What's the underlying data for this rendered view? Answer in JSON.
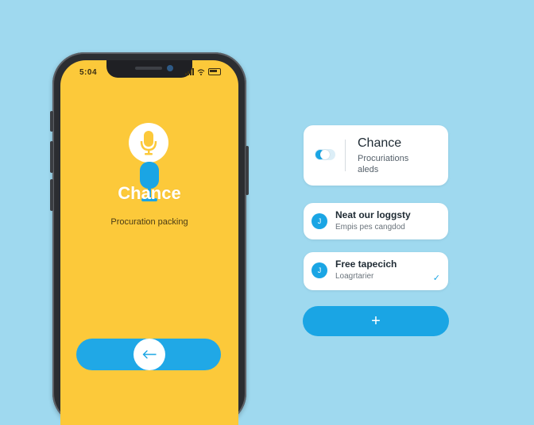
{
  "status_bar": {
    "time": "5:04"
  },
  "phone_screen": {
    "title": "Chance",
    "subtitle": "Procuration packing",
    "back_icon": "arrow-left-icon",
    "mic_icon": "microphone-icon"
  },
  "main_card": {
    "title": "Chance",
    "line1": "Procuriations",
    "line2": "aleds"
  },
  "list_items": [
    {
      "title": "Neat our loggsty",
      "subtitle": "Empis pes cangdod",
      "marker": "J"
    },
    {
      "title": "Free tapecich",
      "subtitle": "Loagrtarier",
      "marker": "J",
      "check_icon": "check-icon"
    }
  ],
  "add_button": {
    "label": "+"
  },
  "colors": {
    "background": "#9fd9ef",
    "screen": "#fcc93a",
    "accent": "#1aa5e4"
  }
}
